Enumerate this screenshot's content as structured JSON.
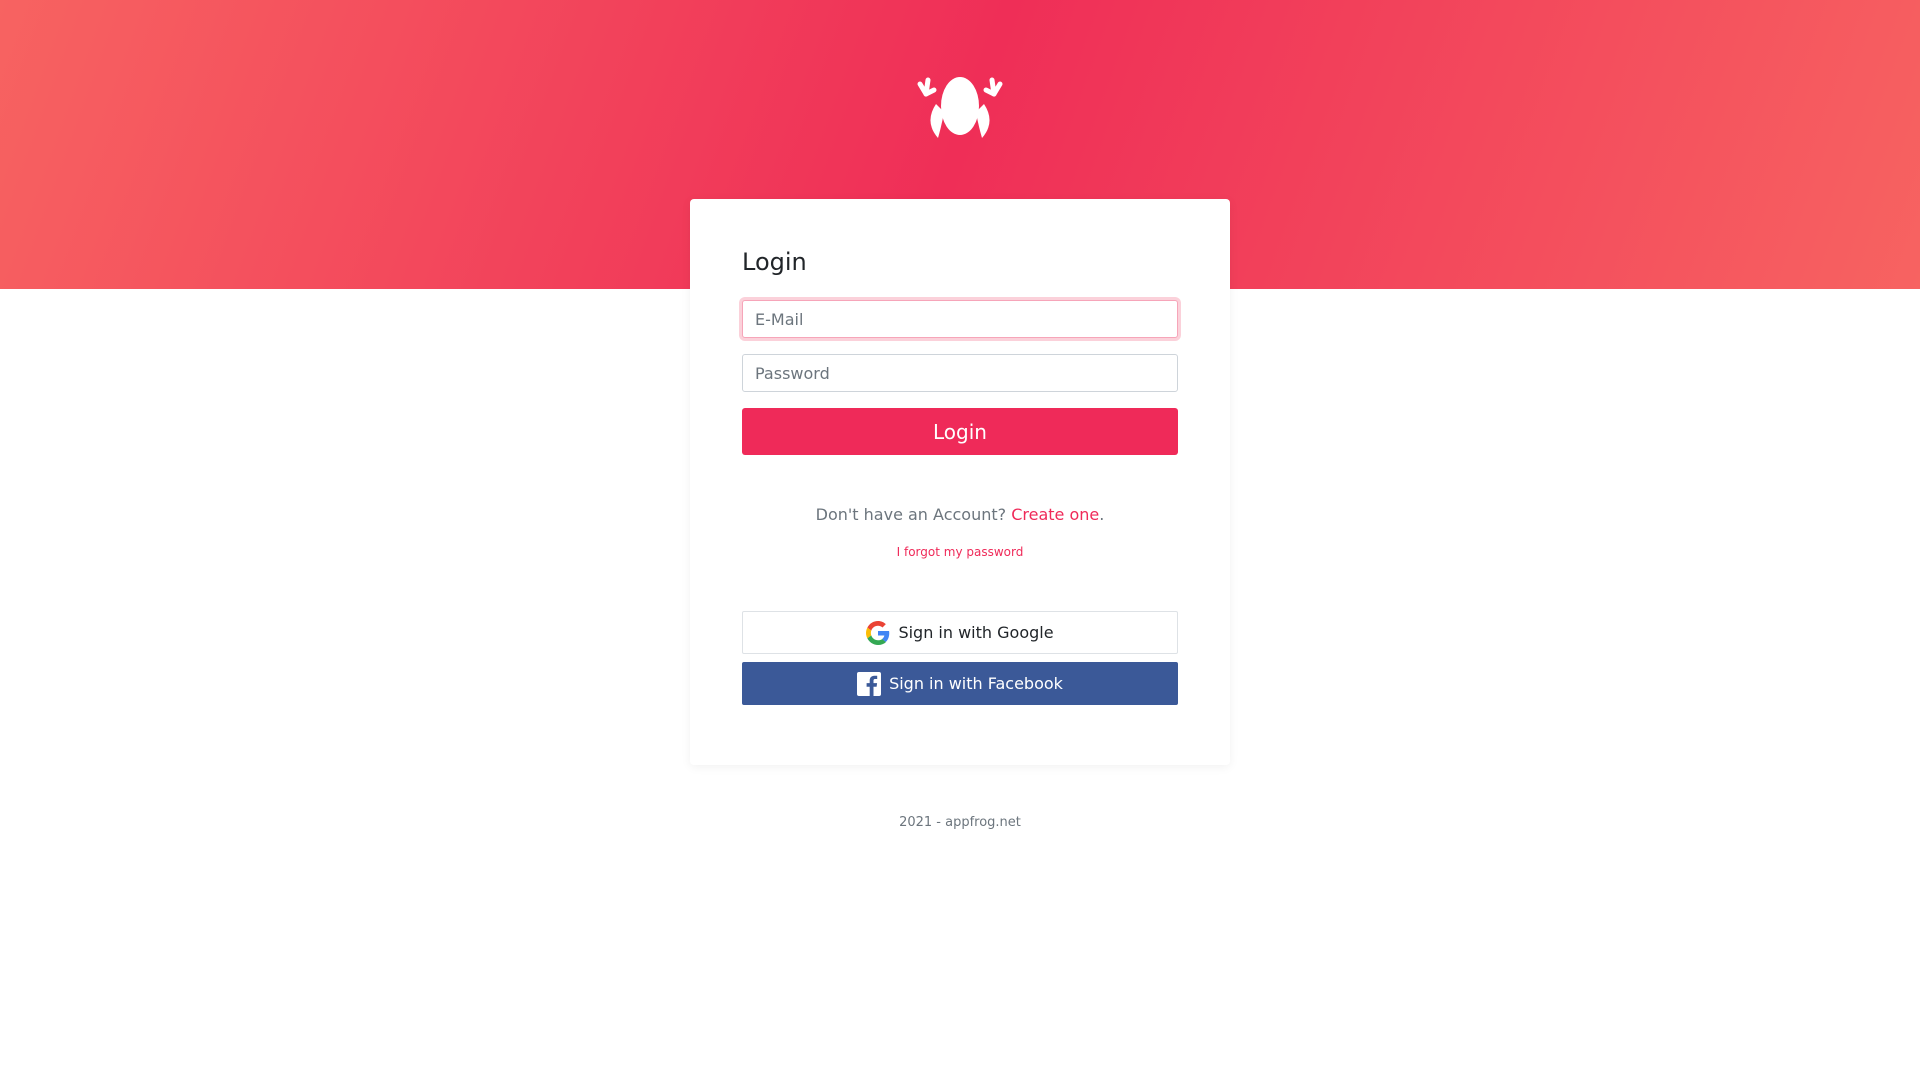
{
  "brand": {
    "logo_icon": "frog-logo-icon",
    "header_gradient": [
      "#f76361",
      "#ef2e57"
    ],
    "accent_color": "#ef2a59"
  },
  "login_card": {
    "title": "Login",
    "email": {
      "placeholder": "E-Mail",
      "value": ""
    },
    "password": {
      "placeholder": "Password",
      "value": ""
    },
    "login_button": "Login",
    "signup_prompt": "Don't have an Account?",
    "signup_link": "Create one",
    "signup_suffix": ".",
    "forgot_link": "I forgot my password"
  },
  "social": {
    "google": {
      "label": "Sign in with Google",
      "icon": "google-icon"
    },
    "facebook": {
      "label": "Sign in with Facebook",
      "icon": "facebook-icon",
      "color": "#3b5998"
    }
  },
  "footer": {
    "text": "2021 - appfrog.net"
  }
}
